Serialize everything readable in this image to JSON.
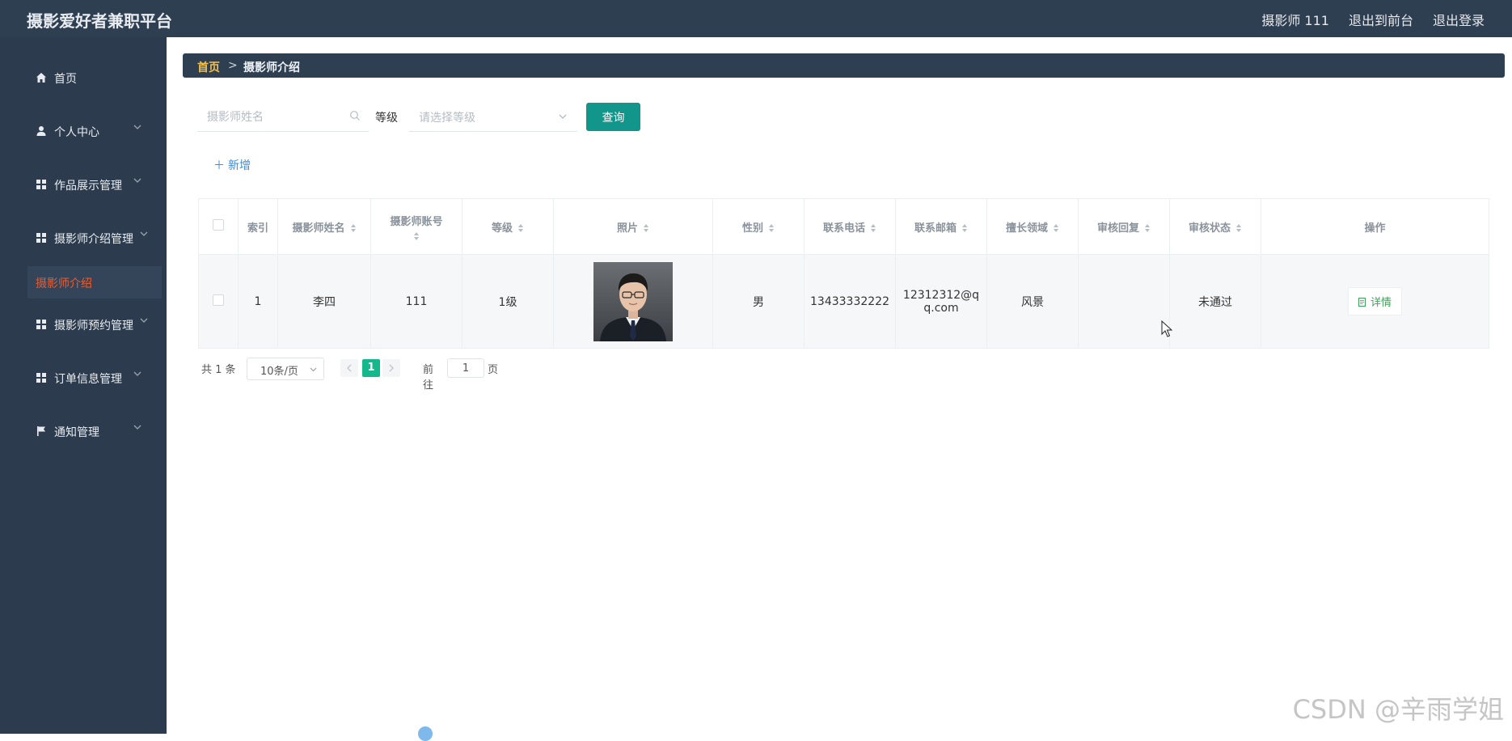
{
  "app": {
    "title": "摄影爱好者兼职平台"
  },
  "topbar": {
    "user": "摄影师 111",
    "to_front": "退出到前台",
    "logout": "退出登录"
  },
  "sidebar": {
    "items": [
      {
        "label": "首页",
        "icon": "home-icon"
      },
      {
        "label": "个人中心",
        "icon": "user-icon"
      },
      {
        "label": "作品展示管理",
        "icon": "grid-icon"
      },
      {
        "label": "摄影师介绍管理",
        "icon": "grid-icon"
      },
      {
        "label": "摄影师预约管理",
        "icon": "grid-icon"
      },
      {
        "label": "订单信息管理",
        "icon": "grid-icon"
      },
      {
        "label": "通知管理",
        "icon": "flag-icon"
      }
    ],
    "active_sub": "摄影师介绍"
  },
  "breadcrumb": {
    "home": "首页",
    "sep": ">",
    "current": "摄影师介绍"
  },
  "search": {
    "name_placeholder": "摄影师姓名",
    "level_label": "等级",
    "level_placeholder": "请选择等级",
    "query": "查询",
    "add": "新增"
  },
  "table": {
    "headers": [
      "索引",
      "摄影师姓名",
      "摄影师账号",
      "等级",
      "照片",
      "性别",
      "联系电话",
      "联系邮箱",
      "擅长领域",
      "审核回复",
      "审核状态",
      "操作"
    ],
    "rows": [
      {
        "index": "1",
        "name": "李四",
        "account": "111",
        "level": "1级",
        "gender": "男",
        "phone": "13433332222",
        "email_line1": "12312312@q",
        "email_line2": "q.com",
        "field": "风景",
        "reply": "",
        "status": "未通过",
        "action": "详情"
      }
    ]
  },
  "pagination": {
    "total": "共 1 条",
    "page_size": "10条/页",
    "current": "1",
    "goto_label": "前往",
    "goto_value": "1",
    "unit": "页"
  },
  "watermark": "CSDN @辛雨学姐",
  "colors": {
    "topbar": "#2f3f52",
    "sidebar": "#2c3b4d",
    "active": "#f05a2a",
    "primary": "#12958a",
    "page_active": "#15b88a"
  }
}
